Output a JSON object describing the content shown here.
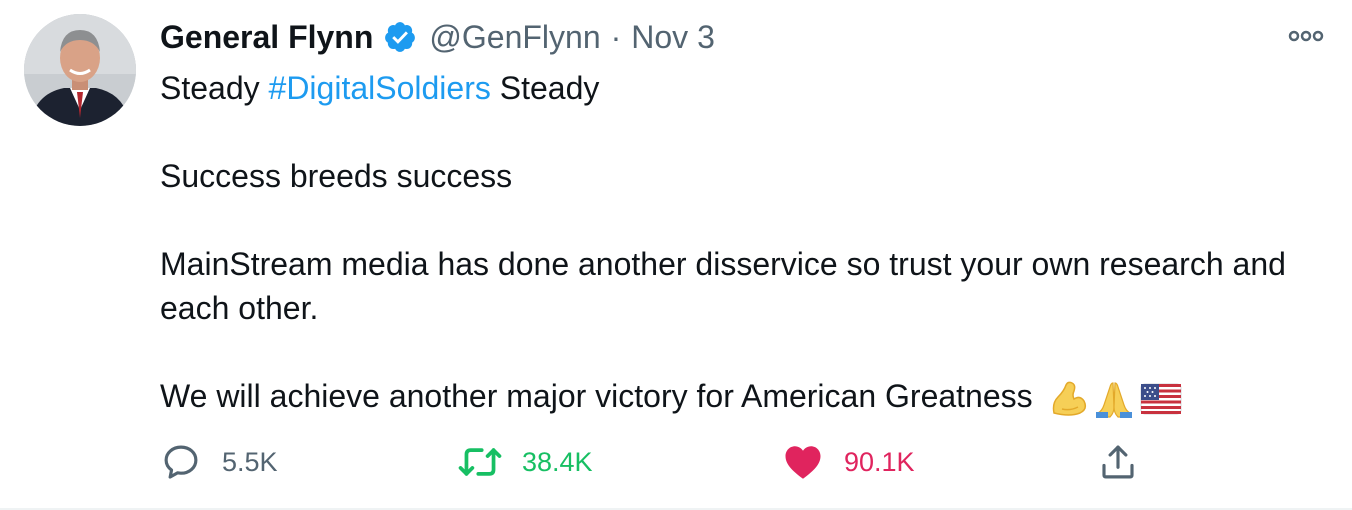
{
  "tweet": {
    "author": {
      "display_name": "General Flynn",
      "handle": "@GenFlynn",
      "verified": true
    },
    "separator": "·",
    "date": "Nov 3",
    "body": {
      "line1_before": "Steady ",
      "hashtag": "#DigitalSoldiers",
      "line1_after": " Steady",
      "para2": "Success breeds success",
      "para3": "MainStream media has done another disservice so trust your own research and each other.",
      "para4": "We will achieve another major victory for American Greatness",
      "emojis": [
        "flexed-biceps",
        "folded-hands",
        "us-flag"
      ]
    },
    "actions": {
      "reply_count": "5.5K",
      "retweet_count": "38.4K",
      "like_count": "90.1K"
    },
    "colors": {
      "hashtag": "#1d9bf0",
      "retweet": "#17bf63",
      "like": "#e0245e",
      "muted": "#536471"
    }
  }
}
